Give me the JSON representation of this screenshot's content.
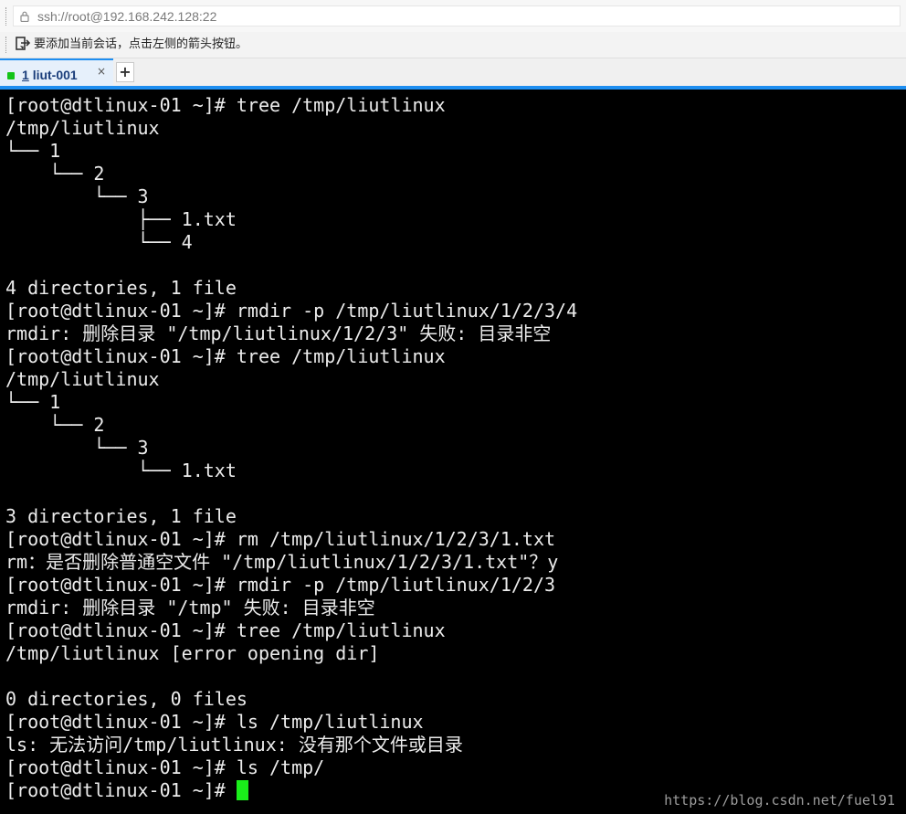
{
  "address_bar": {
    "url": "ssh://root@192.168.242.128:22",
    "lock_icon": "lock-icon"
  },
  "hint_bar": {
    "icon": "session-arrow-icon",
    "text": "要添加当前会话，点击左侧的箭头按钮。"
  },
  "tabs": [
    {
      "number": "1",
      "name": "liut-001",
      "status_color": "#13c418",
      "close_label": "×"
    }
  ],
  "new_tab_label": "+",
  "colors": {
    "accent": "#1e8ef0",
    "terminal_bg": "#000000",
    "terminal_fg": "#ececec",
    "cursor": "#1aee1a"
  },
  "terminal": {
    "lines": [
      "[root@dtlinux-01 ~]# tree /tmp/liutlinux",
      "/tmp/liutlinux",
      "└── 1",
      "    └── 2",
      "        └── 3",
      "            ├── 1.txt",
      "            └── 4",
      "",
      "4 directories, 1 file",
      "[root@dtlinux-01 ~]# rmdir -p /tmp/liutlinux/1/2/3/4",
      "rmdir: 删除目录 \"/tmp/liutlinux/1/2/3\" 失败: 目录非空",
      "[root@dtlinux-01 ~]# tree /tmp/liutlinux",
      "/tmp/liutlinux",
      "└── 1",
      "    └── 2",
      "        └── 3",
      "            └── 1.txt",
      "",
      "3 directories, 1 file",
      "[root@dtlinux-01 ~]# rm /tmp/liutlinux/1/2/3/1.txt",
      "rm：是否删除普通空文件 \"/tmp/liutlinux/1/2/3/1.txt\"？y",
      "[root@dtlinux-01 ~]# rmdir -p /tmp/liutlinux/1/2/3",
      "rmdir: 删除目录 \"/tmp\" 失败: 目录非空",
      "[root@dtlinux-01 ~]# tree /tmp/liutlinux",
      "/tmp/liutlinux [error opening dir]",
      "",
      "0 directories, 0 files",
      "[root@dtlinux-01 ~]# ls /tmp/liutlinux",
      "ls: 无法访问/tmp/liutlinux: 没有那个文件或目录",
      "[root@dtlinux-01 ~]# ls /tmp/"
    ],
    "prompt": "[root@dtlinux-01 ~]# "
  },
  "watermark": "https://blog.csdn.net/fuel91"
}
